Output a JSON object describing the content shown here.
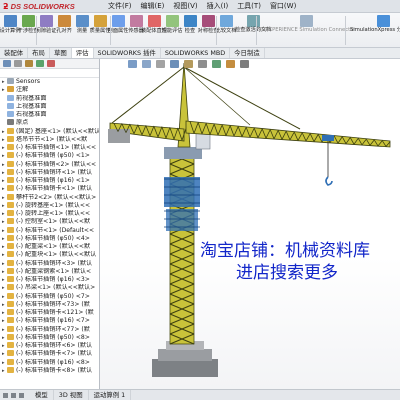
{
  "app": {
    "logo_text": "DS SOLIDWORKS",
    "menus": [
      "文件(F)",
      "编辑(E)",
      "视图(V)",
      "插入(I)",
      "工具(T)",
      "窗口(W)"
    ]
  },
  "ribbon": {
    "buttons": [
      {
        "label": "设计算例",
        "icon": "design-study-icon",
        "color": "#4f86c6"
      },
      {
        "label": "干涉检查",
        "icon": "interference-icon",
        "color": "#6aa84f"
      },
      {
        "label": "间隙验证",
        "icon": "clearance-icon",
        "color": "#8e7cc3"
      },
      {
        "label": "孔对齐",
        "icon": "hole-align-icon",
        "color": "#cc8a3c"
      },
      {
        "label": "测量",
        "icon": "measure-icon",
        "color": "#5b8fc9"
      },
      {
        "label": "质量属性",
        "icon": "mass-properties-icon",
        "color": "#d5a23a"
      },
      {
        "label": "剖面属性",
        "icon": "section-properties-icon",
        "color": "#6d9eeb"
      },
      {
        "label": "传感器",
        "icon": "sensor-icon",
        "color": "#c27ba0"
      },
      {
        "label": "装配体直观",
        "icon": "assembly-visualization-icon",
        "color": "#e06666"
      },
      {
        "label": "性能评估",
        "icon": "performance-icon",
        "color": "#93c47d"
      },
      {
        "label": "检查",
        "icon": "check-icon",
        "color": "#3d85c6"
      },
      {
        "label": "对称检查",
        "icon": "symmetry-icon",
        "color": "#a64d79"
      },
      {
        "label": "比较文档",
        "icon": "compare-icon",
        "color": "#6fa8dc"
      },
      {
        "label": "检查激活的文档",
        "icon": "check-active-icon",
        "color": "#76a5af"
      },
      {
        "label": "3DEXPERIENCE Simulation Connector",
        "icon": "3dx-icon",
        "color": "#9fb3c8"
      },
      {
        "label": "SimulationXpress 分析向导",
        "icon": "simxpress-icon",
        "color": "#4a90d9"
      }
    ]
  },
  "cm_tabs": [
    "装配体",
    "布局",
    "草图",
    "评估",
    "SOLIDWORKS 插件",
    "SOLIDWORKS MBD",
    "今日制造"
  ],
  "cm_active": "评估",
  "tree": {
    "rows": [
      {
        "text": "Sensors",
        "icon": "sensor-folder-icon",
        "color": "#9aa7b5",
        "expand": "▸"
      },
      {
        "text": "注解",
        "icon": "annotation-icon",
        "color": "#d8a23a",
        "expand": "▸"
      },
      {
        "text": "前视基准面",
        "icon": "plane-icon",
        "color": "#8fb3e0",
        "expand": ""
      },
      {
        "text": "上视基准面",
        "icon": "plane-icon",
        "color": "#8fb3e0",
        "expand": ""
      },
      {
        "text": "右视基准面",
        "icon": "plane-icon",
        "color": "#8fb3e0",
        "expand": ""
      },
      {
        "text": "原点",
        "icon": "origin-icon",
        "color": "#7a7a7a",
        "expand": ""
      },
      {
        "text": "(固定) 基座<1> (默认<<默认>",
        "icon": "part-icon",
        "color": "#e3b341",
        "expand": "▸"
      },
      {
        "text": "塔吊节节<1> (默认<<默",
        "icon": "part-icon",
        "color": "#e3b341",
        "expand": "▸"
      },
      {
        "text": "(-) 标准节插销<1> (默认<<",
        "icon": "part-icon",
        "color": "#e3b341",
        "expand": "▸"
      },
      {
        "text": "(-) 标准节插销 (φ50) <1>",
        "icon": "part-icon",
        "color": "#e3b341",
        "expand": "▸"
      },
      {
        "text": "(-) 标准节插销<2> (默认<<",
        "icon": "part-icon",
        "color": "#e3b341",
        "expand": "▸"
      },
      {
        "text": "(-) 标准节插销环<1> (默认",
        "icon": "part-icon",
        "color": "#e3b341",
        "expand": "▸"
      },
      {
        "text": "(-) 标准节插销 (φ16) <1>",
        "icon": "part-icon",
        "color": "#e3b341",
        "expand": "▸"
      },
      {
        "text": "(-) 标准节插销卡<1> (默认",
        "icon": "part-icon",
        "color": "#e3b341",
        "expand": "▸"
      },
      {
        "text": "攀杆节2<2> (默认<<默认>",
        "icon": "part-icon",
        "color": "#e3b341",
        "expand": "▸"
      },
      {
        "text": "(-) 旋转基座<1> (默认<<",
        "icon": "part-icon",
        "color": "#e3b341",
        "expand": "▸"
      },
      {
        "text": "(-) 旋转上座<1> (默认<<",
        "icon": "part-icon",
        "color": "#e3b341",
        "expand": "▸"
      },
      {
        "text": "(-) 控制室<1> (默认<<默",
        "icon": "part-icon",
        "color": "#e3b341",
        "expand": "▸"
      },
      {
        "text": "(-) 标准节<1> (Default<<",
        "icon": "part-icon",
        "color": "#e3b341",
        "expand": "▸"
      },
      {
        "text": "(-) 标准节插销 (φ50) <4>",
        "icon": "part-icon",
        "color": "#e3b341",
        "expand": "▸"
      },
      {
        "text": "(-) 配重梁<1> (默认<<默",
        "icon": "part-icon",
        "color": "#e3b341",
        "expand": "▸"
      },
      {
        "text": "(-) 配重块<1> (默认<<默认",
        "icon": "part-icon",
        "color": "#e3b341",
        "expand": "▸"
      },
      {
        "text": "(-) 标准节插销环<3> (默认",
        "icon": "part-icon",
        "color": "#e3b341",
        "expand": "▸"
      },
      {
        "text": "(-) 配重梁钢索<1> (默认<",
        "icon": "part-icon",
        "color": "#e3b341",
        "expand": "▸"
      },
      {
        "text": "(-) 标准节插销 (φ16) <3>",
        "icon": "part-icon",
        "color": "#e3b341",
        "expand": "▸"
      },
      {
        "text": "(-) 吊梁<1> (默认<<默认>",
        "icon": "part-icon",
        "color": "#e3b341",
        "expand": "▸"
      },
      {
        "text": "(-) 标准节插销 (φ50) <7>",
        "icon": "part-icon",
        "color": "#e3b341",
        "expand": "▸"
      },
      {
        "text": "(-) 标准节插销环<73> (默",
        "icon": "part-icon",
        "color": "#e3b341",
        "expand": "▸"
      },
      {
        "text": "(-) 标准节插销卡<121> (默",
        "icon": "part-icon",
        "color": "#e3b341",
        "expand": "▸"
      },
      {
        "text": "(-) 标准节插销 (φ16) <7>",
        "icon": "part-icon",
        "color": "#e3b341",
        "expand": "▸"
      },
      {
        "text": "(-) 标准节插销环<77> (默",
        "icon": "part-icon",
        "color": "#e3b341",
        "expand": "▸"
      },
      {
        "text": "(-) 标准节插销 (φ50) <8>",
        "icon": "part-icon",
        "color": "#e3b341",
        "expand": "▸"
      },
      {
        "text": "(-) 标准节插销环<6> (默认",
        "icon": "part-icon",
        "color": "#e3b341",
        "expand": "▸"
      },
      {
        "text": "(-) 标准节插销卡<7> (默认",
        "icon": "part-icon",
        "color": "#e3b341",
        "expand": "▸"
      },
      {
        "text": "(-) 标准节插销 (φ16) <8>",
        "icon": "part-icon",
        "color": "#e3b341",
        "expand": "▸"
      },
      {
        "text": "(-) 标准节插销卡<8> (默认",
        "icon": "part-icon",
        "color": "#e3b341",
        "expand": "▸"
      }
    ]
  },
  "status_tabs": [
    "模型",
    "3D 视图",
    "运动算例 1"
  ],
  "watermark": {
    "line1": "淘宝店铺：机械资料库",
    "line2": "进店搜索更多"
  },
  "colors": {
    "crane_yellow": "#c9c33a",
    "crane_dark": "#565a1e",
    "cab_blue": "#2f6fb5",
    "base_gray": "#8a8d91",
    "watermark_blue": "#1226c9"
  }
}
